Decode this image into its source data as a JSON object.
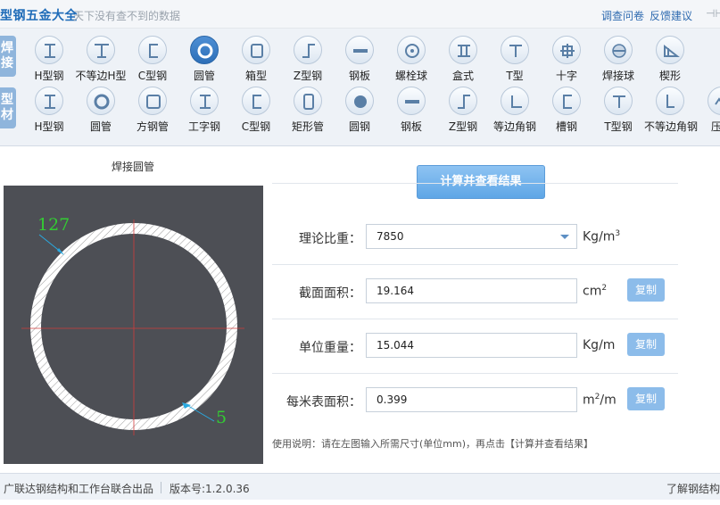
{
  "titlebar": {
    "title": "型钢五金大全",
    "slogan": "天下没有查不到的数据",
    "survey_link": "调查问卷",
    "feedback_link": "反馈建议",
    "pin": "⊣⊢"
  },
  "toolbar": {
    "tab_welding": "焊\n接",
    "tab_profile": "型\n材",
    "row1": [
      {
        "label": "H型钢",
        "icon": "h-beam-icon"
      },
      {
        "label": "不等边H型",
        "icon": "unequal-h-icon"
      },
      {
        "label": "C型钢",
        "icon": "c-channel-icon"
      },
      {
        "label": "圆管",
        "icon": "round-tube-icon",
        "active": true
      },
      {
        "label": "箱型",
        "icon": "box-section-icon"
      },
      {
        "label": "Z型钢",
        "icon": "z-section-icon"
      },
      {
        "label": "钢板",
        "icon": "steel-plate-icon"
      },
      {
        "label": "螺栓球",
        "icon": "bolt-ball-icon"
      },
      {
        "label": "盒式",
        "icon": "box-type-icon"
      },
      {
        "label": "T型",
        "icon": "t-section-icon"
      },
      {
        "label": "十字",
        "icon": "cross-section-icon"
      },
      {
        "label": "焊接球",
        "icon": "welded-ball-icon"
      },
      {
        "label": "楔形",
        "icon": "wedge-icon"
      }
    ],
    "row2": [
      {
        "label": "H型钢",
        "icon": "h-beam-icon"
      },
      {
        "label": "圆管",
        "icon": "round-tube-icon"
      },
      {
        "label": "方钢管",
        "icon": "square-tube-icon"
      },
      {
        "label": "工字钢",
        "icon": "i-beam-icon"
      },
      {
        "label": "C型钢",
        "icon": "c-channel-icon"
      },
      {
        "label": "矩形管",
        "icon": "rect-tube-icon"
      },
      {
        "label": "圆钢",
        "icon": "round-bar-icon"
      },
      {
        "label": "钢板",
        "icon": "steel-plate-icon"
      },
      {
        "label": "Z型钢",
        "icon": "z-section-icon"
      },
      {
        "label": "等边角钢",
        "icon": "equal-angle-icon"
      },
      {
        "label": "槽钢",
        "icon": "channel-icon"
      },
      {
        "label": "T型钢",
        "icon": "t-section-icon"
      },
      {
        "label": "不等边角钢",
        "icon": "unequal-angle-icon"
      },
      {
        "label": "压型",
        "icon": "profiled-sheet-icon"
      }
    ]
  },
  "diagram": {
    "title": "焊接圆管",
    "diameter_value": "127",
    "thickness_value": "5"
  },
  "form": {
    "calc_button": "计算并查看结果",
    "density": {
      "label": "理论比重：",
      "value": "7850",
      "unit": "Kg/m",
      "unit_sup": "3"
    },
    "area": {
      "label": "截面面积：",
      "value": "19.164",
      "unit": "cm",
      "unit_sup": "2",
      "copy": "复制"
    },
    "weight": {
      "label": "单位重量：",
      "value": "15.044",
      "unit": "Kg/m",
      "copy": "复制"
    },
    "surface": {
      "label": "每米表面积：",
      "value": "0.399",
      "unit_pre": "m",
      "unit_sup": "2",
      "unit_post": "/m",
      "copy": "复制"
    },
    "usage": "使用说明：请在左图输入所需尺寸(单位mm)，再点击【计算并查看结果】"
  },
  "footer": {
    "credit": "广联达钢结构和工作台联合出品",
    "version": "版本号:1.2.0.36",
    "right_link": "了解钢结构"
  },
  "colors": {
    "accent": "#1e6bb8",
    "button": "#5ea6e6",
    "diagram_bg": "#4d4f55",
    "dimension_text": "#33cc33"
  }
}
